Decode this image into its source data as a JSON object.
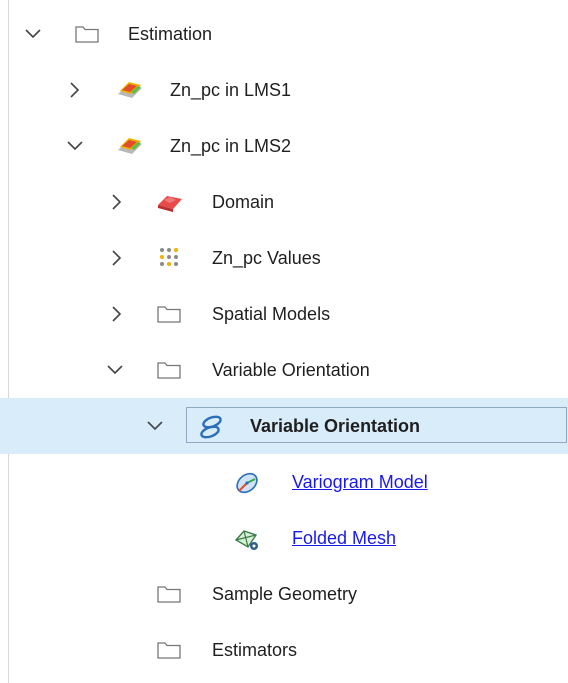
{
  "tree": {
    "estimation": {
      "label": "Estimation",
      "icon": "folder-icon",
      "expanded": true
    },
    "zn_lms1": {
      "label": "Zn_pc in LMS1",
      "icon": "block-model-icon",
      "expanded": false
    },
    "zn_lms2": {
      "label": "Zn_pc in LMS2",
      "icon": "block-model-icon",
      "expanded": true
    },
    "domain": {
      "label": "Domain",
      "icon": "domain-icon",
      "expanded": false
    },
    "values": {
      "label": "Zn_pc Values",
      "icon": "points-icon",
      "expanded": false
    },
    "spatial_models": {
      "label": "Spatial Models",
      "icon": "folder-icon",
      "expanded": false
    },
    "variable_orientation_folder": {
      "label": "Variable Orientation",
      "icon": "folder-icon",
      "expanded": true
    },
    "variable_orientation_item": {
      "label": "Variable Orientation",
      "icon": "variable-orientation-icon",
      "expanded": true,
      "selected": true
    },
    "variogram_model": {
      "label": "Variogram Model",
      "icon": "variogram-icon",
      "link": true
    },
    "folded_mesh": {
      "label": "Folded Mesh",
      "icon": "folded-mesh-icon",
      "link": true
    },
    "sample_geometry": {
      "label": "Sample Geometry",
      "icon": "folder-icon"
    },
    "estimators": {
      "label": "Estimators",
      "icon": "folder-icon"
    }
  },
  "colors": {
    "selection_bg": "#d9ecfa",
    "link": "#1a1ae6",
    "icon_blue": "#2a6fb8"
  }
}
